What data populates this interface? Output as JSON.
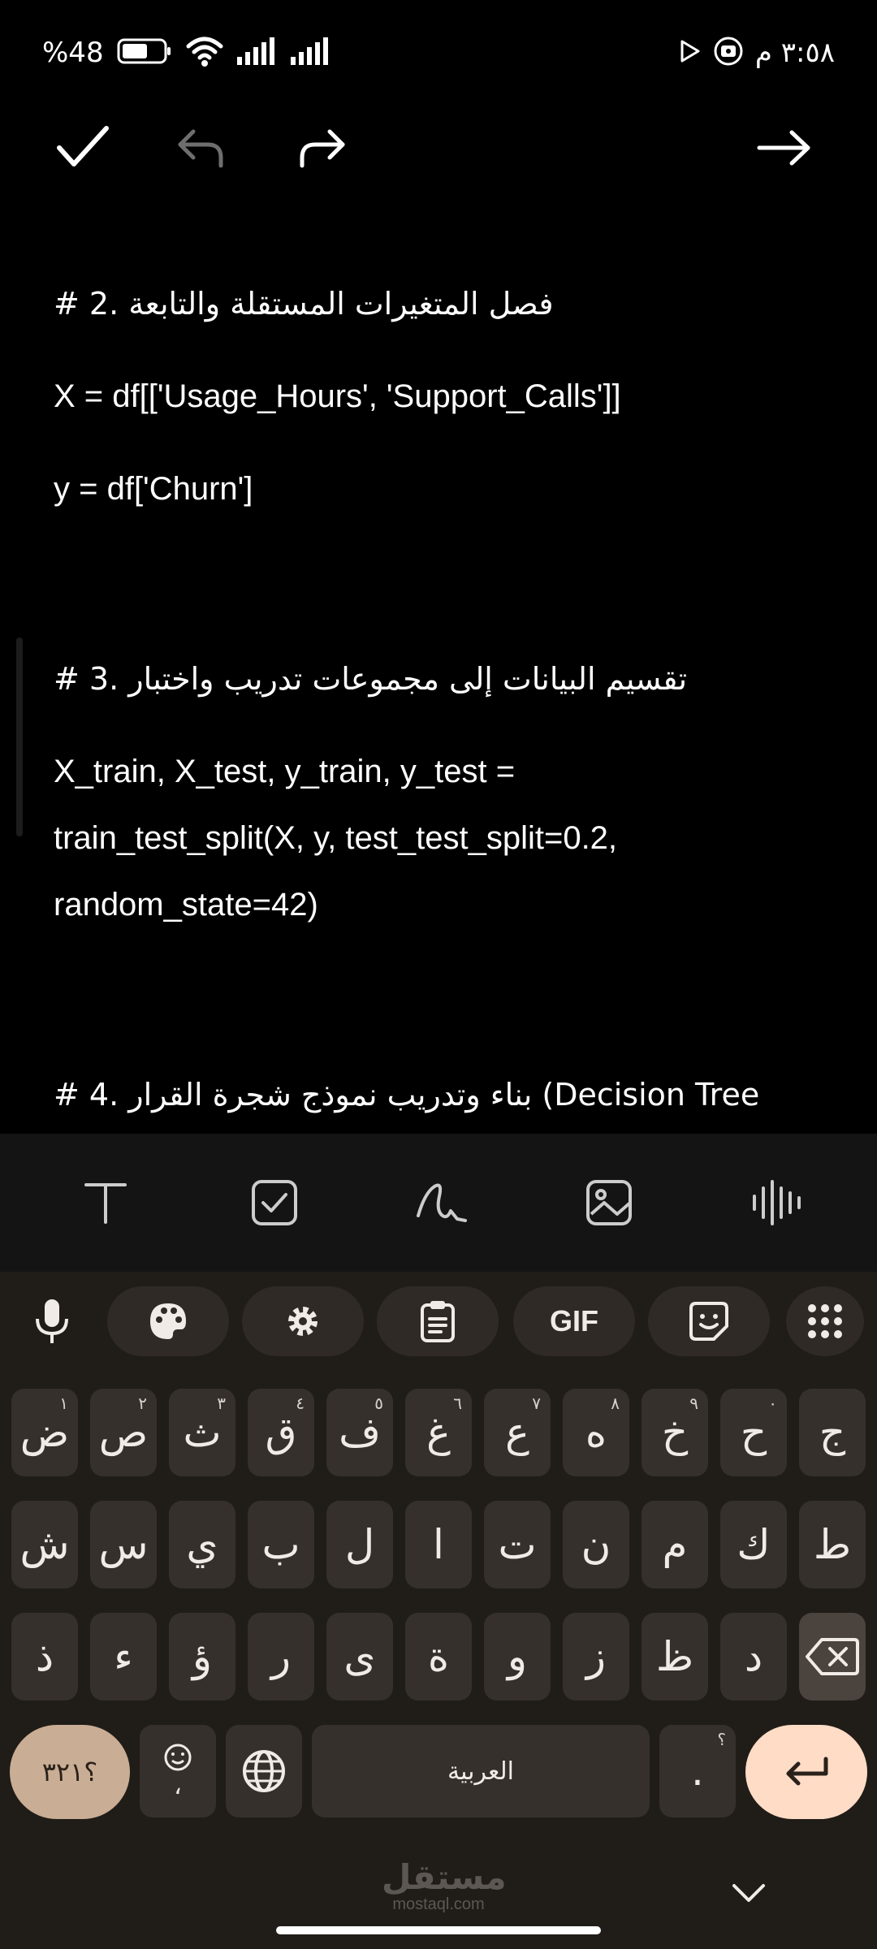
{
  "status_bar": {
    "battery_text": "%48",
    "time": "٣:٥٨ م"
  },
  "editor_lines": [
    "# 2. فصل المتغيرات المستقلة والتابعة",
    "X = df[['Usage_Hours', 'Support_Calls']]",
    "y = df['Churn']",
    "# 3. تقسيم البيانات إلى مجموعات تدريب واختبار",
    "X_train, X_test, y_train, y_test =",
    "train_test_split(X, y, test_test_split=0.2,",
    "random_state=42)",
    "# 4. بناء وتدريب نموذج شجرة القرار (Decision Tree"
  ],
  "keyboard": {
    "suggestions": {
      "gif_label": "GIF"
    },
    "row1": [
      {
        "key": "ج",
        "hint": ""
      },
      {
        "key": "ح",
        "hint": "٠"
      },
      {
        "key": "خ",
        "hint": "٩"
      },
      {
        "key": "ه",
        "hint": "٨"
      },
      {
        "key": "ع",
        "hint": "٧"
      },
      {
        "key": "غ",
        "hint": "٦"
      },
      {
        "key": "ف",
        "hint": "٥"
      },
      {
        "key": "ق",
        "hint": "٤"
      },
      {
        "key": "ث",
        "hint": "٣"
      },
      {
        "key": "ص",
        "hint": "٢"
      },
      {
        "key": "ض",
        "hint": "١"
      }
    ],
    "row2": [
      "ط",
      "ك",
      "م",
      "ن",
      "ت",
      "ا",
      "ل",
      "ب",
      "ي",
      "س",
      "ش"
    ],
    "row3": [
      "د",
      "ظ",
      "ز",
      "و",
      "ة",
      "ى",
      "ر",
      "ؤ",
      "ء",
      "ذ"
    ],
    "symbols_label": "؟٣٢١",
    "emoji_comma": "،",
    "space_label": "العربية",
    "period_label": ".",
    "period_hint": "؟"
  },
  "watermark": {
    "arabic": "مستقل",
    "latin": "mostaql.com"
  }
}
